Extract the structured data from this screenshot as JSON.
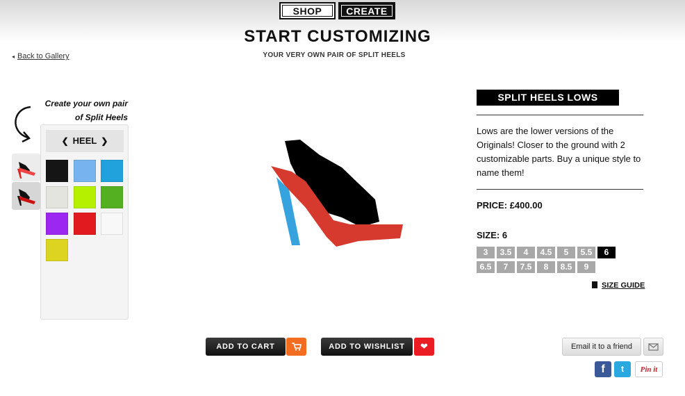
{
  "nav": {
    "shop": "SHOP",
    "create": "CREATE"
  },
  "header": {
    "title": "START CUSTOMIZING",
    "subtitle": "YOUR VERY OWN PAIR OF SPLIT HEELS"
  },
  "back": {
    "arrow": "◂",
    "label": "Back to Gallery"
  },
  "helper": {
    "line1": "Create your own pair",
    "line2": "of Split Heels"
  },
  "customizer": {
    "part_label": "HEEL",
    "prev": "❮",
    "next": "❯",
    "swatches": [
      {
        "name": "black",
        "color": "#151515"
      },
      {
        "name": "light-blue",
        "color": "#77b3ef"
      },
      {
        "name": "blue",
        "color": "#22a2dd"
      },
      {
        "name": "light-grey",
        "color": "#e4e4de"
      },
      {
        "name": "lime",
        "color": "#b4f000"
      },
      {
        "name": "green",
        "color": "#55b021"
      },
      {
        "name": "purple",
        "color": "#9b27f0"
      },
      {
        "name": "red",
        "color": "#e01a1f"
      },
      {
        "name": "white",
        "color": "#f8f8f8"
      },
      {
        "name": "yellow",
        "color": "#dcd420"
      }
    ]
  },
  "product": {
    "title": "SPLIT HEELS LOWS",
    "description": "Lows are the lower versions of the Originals! Closer to the ground with 2 customizable parts. Buy a unique style to name them!",
    "price_label": "PRICE:",
    "price_value": "£400.00",
    "size_label": "SIZE:",
    "size_value": "6",
    "sizes": [
      "3",
      "3.5",
      "4",
      "4.5",
      "5",
      "5.5",
      "6",
      "6.5",
      "7",
      "7.5",
      "8",
      "8.5",
      "9"
    ],
    "selected_size": "6",
    "size_guide": "SIZE GUIDE"
  },
  "actions": {
    "add_to_cart": "ADD TO CART",
    "add_to_wishlist": "ADD TO WISHLIST",
    "email_friend": "Email it to a friend",
    "cart_icon": "cart-icon",
    "heart_icon": "heart-icon"
  },
  "social": {
    "facebook": "f",
    "twitter": "t",
    "pinterest": "Pin it"
  },
  "colors": {
    "black": "#000000",
    "cart_orange": "#f26d1f",
    "wish_red": "#ec1c24",
    "size_grey": "#a8a8a8"
  }
}
